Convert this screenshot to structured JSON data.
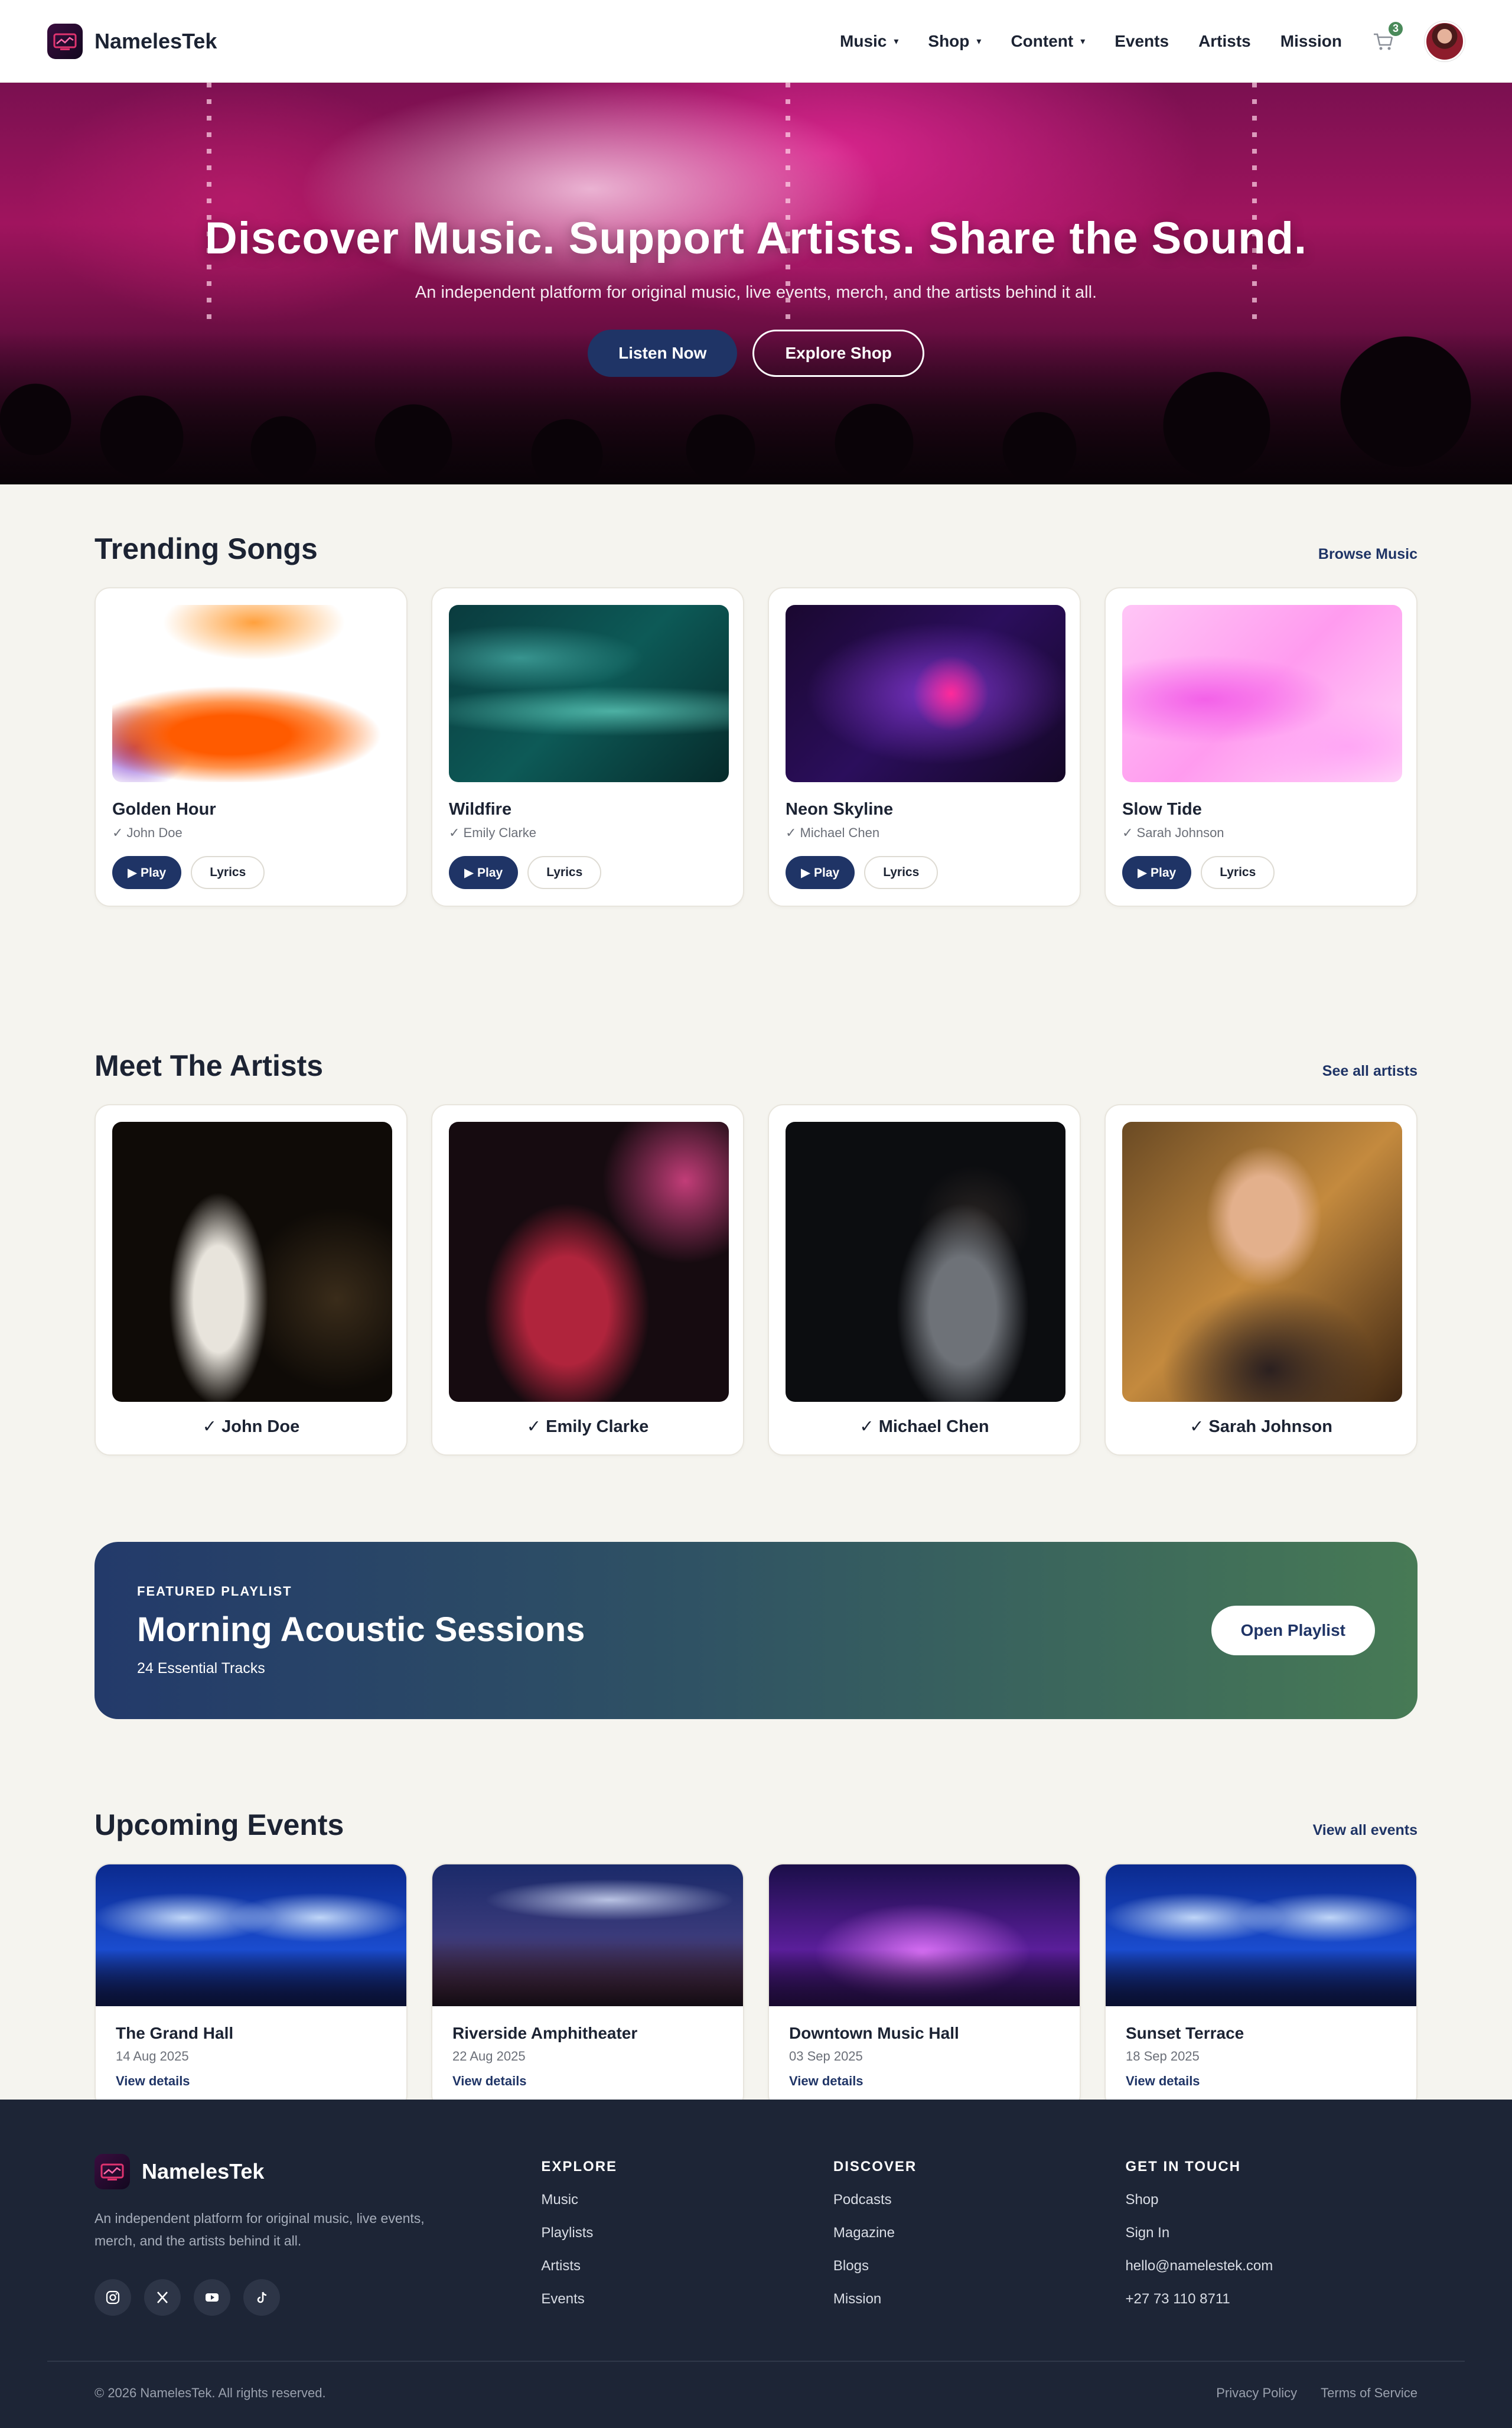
{
  "brand": {
    "name": "NamelesTek"
  },
  "nav": {
    "items": [
      {
        "label": "Music",
        "dropdown": true
      },
      {
        "label": "Shop",
        "dropdown": true
      },
      {
        "label": "Content",
        "dropdown": true
      },
      {
        "label": "Events",
        "dropdown": false
      },
      {
        "label": "Artists",
        "dropdown": false
      },
      {
        "label": "Mission",
        "dropdown": false
      }
    ],
    "cart_count": "3",
    "caret": "▾"
  },
  "hero": {
    "title": "Discover Music. Support Artists. Share the Sound.",
    "subtitle": "An independent platform for original music, live events, merch, and the artists behind it all.",
    "primary_label": "Listen Now",
    "secondary_label": "Explore Shop"
  },
  "songs": {
    "title": "Trending Songs",
    "link": "Browse Music",
    "play_label": "▶ Play",
    "lyrics_label": "Lyrics",
    "items": [
      {
        "title": "Golden Hour",
        "artist": "✓ John Doe"
      },
      {
        "title": "Wildfire",
        "artist": "✓ Emily Clarke"
      },
      {
        "title": "Neon Skyline",
        "artist": "✓ Michael Chen"
      },
      {
        "title": "Slow Tide",
        "artist": "✓ Sarah Johnson"
      }
    ]
  },
  "artists": {
    "title": "Meet The Artists",
    "link": "See all artists",
    "items": [
      {
        "name": "✓ John Doe"
      },
      {
        "name": "✓ Emily Clarke"
      },
      {
        "name": "✓ Michael Chen"
      },
      {
        "name": "✓ Sarah Johnson"
      }
    ]
  },
  "playlist": {
    "kicker": "FEATURED PLAYLIST",
    "title": "Morning Acoustic Sessions",
    "tracks": "24 Essential Tracks",
    "button": "Open Playlist"
  },
  "events": {
    "title": "Upcoming Events",
    "link": "View all events",
    "details_label": "View details",
    "items": [
      {
        "title": "The Grand Hall",
        "date": "14 Aug 2025"
      },
      {
        "title": "Riverside Amphitheater",
        "date": "22 Aug 2025"
      },
      {
        "title": "Downtown Music Hall",
        "date": "03 Sep 2025"
      },
      {
        "title": "Sunset Terrace",
        "date": "18 Sep 2025"
      }
    ]
  },
  "footer": {
    "description": "An independent platform for original music, live events, merch, and the artists behind it all.",
    "socials": [
      "instagram-icon",
      "x-icon",
      "youtube-icon",
      "tiktok-icon"
    ],
    "columns": [
      {
        "title": "EXPLORE",
        "items": [
          "Music",
          "Playlists",
          "Artists",
          "Events"
        ]
      },
      {
        "title": "DISCOVER",
        "items": [
          "Podcasts",
          "Magazine",
          "Blogs",
          "Mission"
        ]
      },
      {
        "title": "GET IN TOUCH",
        "items": [
          "Shop",
          "Sign In",
          "hello@namelestek.com",
          "+27 73 110 8711"
        ]
      }
    ],
    "copyright": "© 2026 NamelesTek. All rights reserved.",
    "legal": [
      "Privacy Policy",
      "Terms of Service"
    ]
  },
  "colors": {
    "primary": "#1f3466",
    "accent_green": "#4a8a5a",
    "page_bg": "#f5f4ef",
    "footer_bg": "#1d2536"
  }
}
